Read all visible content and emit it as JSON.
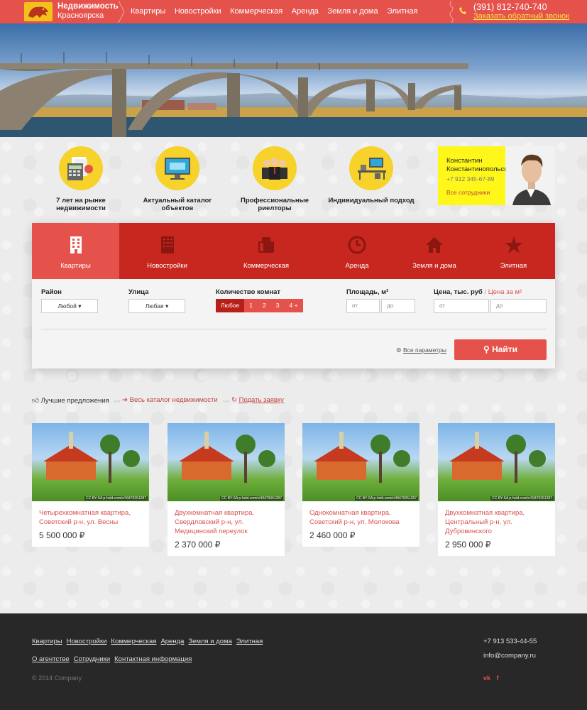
{
  "header": {
    "brand_title": "Недвижимость",
    "brand_city": "Красноярска",
    "nav": [
      "Квартиры",
      "Новостройки",
      "Коммерческая",
      "Аренда",
      "Земля и дома",
      "Элитная"
    ],
    "phone": "(391) 812-740-740",
    "callback": "Заказать обратный звонок"
  },
  "features": [
    {
      "label": "7 лет на рынке недвижимости",
      "icon": "calculator-icon"
    },
    {
      "label": "Актуальный каталог объектов",
      "icon": "monitor-icon"
    },
    {
      "label": "Профессиональные риелторы",
      "icon": "people-icon"
    },
    {
      "label": "Индивидуальный подход",
      "icon": "desk-icon"
    }
  ],
  "agent": {
    "name_line1": "Константин",
    "name_line2": "Константинопольский",
    "phone": "+7 912 345-67-89",
    "all_link": "Все сотрудники"
  },
  "search": {
    "tabs": [
      {
        "label": "Квартиры",
        "icon": "building-icon",
        "active": true
      },
      {
        "label": "Новостройки",
        "icon": "skyscraper-icon",
        "active": false
      },
      {
        "label": "Коммерческая",
        "icon": "fax-icon",
        "active": false
      },
      {
        "label": "Аренда",
        "icon": "clock-icon",
        "active": false
      },
      {
        "label": "Земля и дома",
        "icon": "home-icon",
        "active": false
      },
      {
        "label": "Элитная",
        "icon": "star-icon",
        "active": false
      }
    ],
    "district_label": "Район",
    "district_value": "Любой ▾",
    "street_label": "Улица",
    "street_value": "Любая ▾",
    "rooms_label": "Количество комнат",
    "rooms": [
      "Любое",
      "1",
      "2",
      "3",
      "4 +"
    ],
    "area_label": "Площадь, м²",
    "area_from": "от",
    "area_to": "до",
    "price_label": "Цена, тыс. руб",
    "price_sep": "/",
    "price_alt": "Цена за м²",
    "price_from": "от",
    "price_to": "до",
    "all_params": "Все параметры",
    "find_button": "Найти"
  },
  "listings_header": {
    "best": "Лучшие предложения",
    "catalog": "Весь каталог недвижимости",
    "submit": "Подать заявку"
  },
  "listings": [
    {
      "title": "Четырехкомнатная квартира, Советский р-н, ул. Весны",
      "price": "5 500 000 ₽"
    },
    {
      "title": "Двухкомнатная квартира, Свердловский р-н, ул. Медицинский переулок",
      "price": "2 370 000 ₽"
    },
    {
      "title": "Однокомнатная квартира, Советский р-н, ул. Молокова",
      "price": "2 460 000 ₽"
    },
    {
      "title": "Двухкомнатная квартира, Центральный р-н, ул. Дубровинского",
      "price": "2 950 000 ₽"
    }
  ],
  "image_credit": "CC BY-SA p-hold.com/c/49479351287",
  "footer": {
    "nav1": [
      "Квартиры",
      "Новостройки",
      "Коммерческая",
      "Аренда",
      "Земля и дома",
      "Элитная"
    ],
    "nav2": [
      "О агентстве",
      "Сотрудники",
      "Контактная информация"
    ],
    "copyright": "© 2014 Company",
    "phone": "+7 913 533-44-55",
    "email": "info@company.ru",
    "social": [
      "vk",
      "f"
    ]
  },
  "colors": {
    "accent": "#e5524b",
    "accent_dark": "#c7271e",
    "yellow": "#f6d22a",
    "footer": "#282828"
  }
}
